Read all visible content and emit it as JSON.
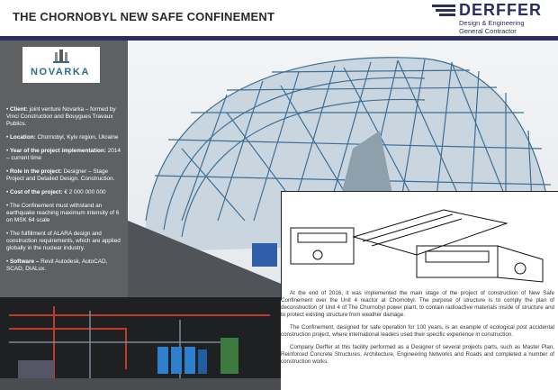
{
  "header": {
    "title": "THE CHORNOBYL NEW SAFE CONFINEMENT",
    "logo_name": "DERFFER",
    "logo_sub1": "Design & Engineering",
    "logo_sub2": "General Contractor"
  },
  "sidebar": {
    "logo_text": "NOVARKA",
    "facts": [
      {
        "label": "Client:",
        "text": " joint venture Novarka – formed by Vinci Construction and Bouygues Travaux Publics."
      },
      {
        "label": "Location:",
        "text": " Chornobyl, Kyiv region, Ukraine"
      },
      {
        "label": "Year of the project implementation:",
        "text": " 2014 – current time"
      },
      {
        "label": "Role in the project:",
        "text": " Designer – Stage Project and Detailed Design. Construction."
      },
      {
        "label": "Cost of the project:",
        "text": " € 2 000 000 000"
      },
      {
        "label": "",
        "text": "The Confinement must withstand an earthquake reaching maximum intensity of 6 on MSK 64 scale"
      },
      {
        "label": "",
        "text": "The fulfillment of ALARA design and construction requirements, which are applied globally in the nuclear industry."
      },
      {
        "label": "Software –",
        "text": " Revit Autodesk, AutoCAD, SCAD, DIALux."
      }
    ]
  },
  "body_text": {
    "p1": "At the end of 2016, it was implemented the main stage of the project of construction of New Safe Confinement over the Unit 4 reactor at Chornobyl. The purpose of structure is to comply the plan of deconstruction of Unit 4 of The Chornobyl power plant, to contain radioactive materials inside of structure and to protect existing structure from weather damage.",
    "p2": "The Confinement, designed for safe operation for 100 years, is an example of ecological post accidental construction project, where international leaders used their specific experience in construction.",
    "p3": "Company Derffer at this facility performed as a Designer of several projects parts, such as Master Plan, Reinforced Concrete Structures, Architecture, Engineering Networks and Roads and completed a number of construction works."
  },
  "colors": {
    "brand": "#2c2f5e",
    "sidebar": "#5f6062",
    "novarka": "#2d6b8f"
  }
}
